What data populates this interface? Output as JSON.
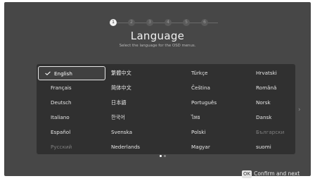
{
  "steps": [
    "1",
    "2",
    "3",
    "4",
    "5",
    "6"
  ],
  "active_step": 1,
  "title": "Language",
  "subtitle": "Select the language for the OSD menus.",
  "languages": [
    {
      "label": "English",
      "selected": true,
      "dim": false
    },
    {
      "label": "Français",
      "selected": false,
      "dim": false
    },
    {
      "label": "Deutsch",
      "selected": false,
      "dim": false
    },
    {
      "label": "Italiano",
      "selected": false,
      "dim": false
    },
    {
      "label": "Español",
      "selected": false,
      "dim": false
    },
    {
      "label": "Русский",
      "selected": false,
      "dim": true
    },
    {
      "label": "繁體中文",
      "selected": false,
      "dim": false
    },
    {
      "label": "简体中文",
      "selected": false,
      "dim": false
    },
    {
      "label": "日本語",
      "selected": false,
      "dim": false
    },
    {
      "label": "한국어",
      "selected": false,
      "dim": false
    },
    {
      "label": "Svenska",
      "selected": false,
      "dim": false
    },
    {
      "label": "Nederlands",
      "selected": false,
      "dim": false
    },
    {
      "label": "Türkçe",
      "selected": false,
      "dim": false
    },
    {
      "label": "Čeština",
      "selected": false,
      "dim": false
    },
    {
      "label": "Português",
      "selected": false,
      "dim": false
    },
    {
      "label": "ไทย",
      "selected": false,
      "dim": false
    },
    {
      "label": "Polski",
      "selected": false,
      "dim": false
    },
    {
      "label": "Magyar",
      "selected": false,
      "dim": false
    },
    {
      "label": "Hrvatski",
      "selected": false,
      "dim": false
    },
    {
      "label": "Română",
      "selected": false,
      "dim": false
    },
    {
      "label": "Norsk",
      "selected": false,
      "dim": false
    },
    {
      "label": "Dansk",
      "selected": false,
      "dim": false
    },
    {
      "label": "Български",
      "selected": false,
      "dim": true
    },
    {
      "label": "suomi",
      "selected": false,
      "dim": false
    }
  ],
  "page_count": 2,
  "active_page": 1,
  "next_page_icon": "chevron-right-icon",
  "footer": {
    "ok_label": "OK",
    "confirm_label": "Confirm and next"
  }
}
